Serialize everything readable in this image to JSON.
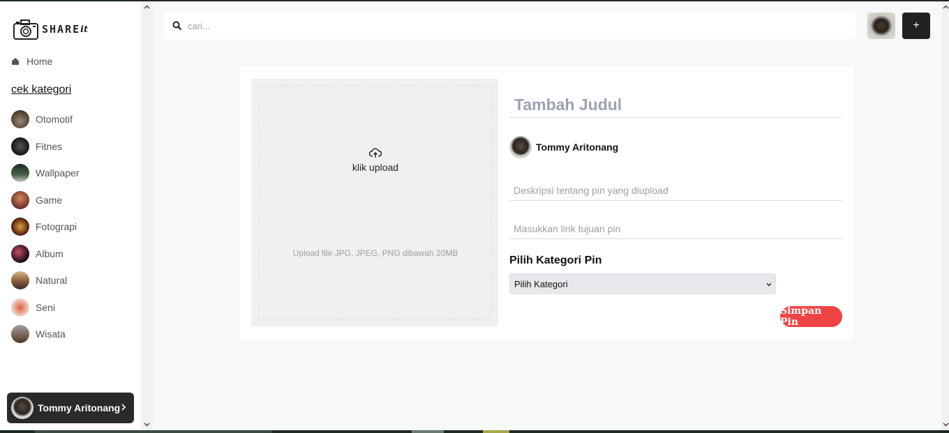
{
  "brand": {
    "name": "SHARE",
    "suffix": "it"
  },
  "sidebar": {
    "home_label": "Home",
    "category_heading": "cek kategori",
    "categories": [
      {
        "label": "Otomotif",
        "color": "#6b5a4a"
      },
      {
        "label": "Fitnes",
        "color": "#2d2d2d"
      },
      {
        "label": "Wallpaper",
        "color": "#3f4f3f"
      },
      {
        "label": "Game",
        "color": "#7a3a2a"
      },
      {
        "label": "Fotograpi",
        "color": "#5a2a1a"
      },
      {
        "label": "Album",
        "color": "#3a1a2a"
      },
      {
        "label": "Natural",
        "color": "#8a6a4a"
      },
      {
        "label": "Seni",
        "color": "#c04030"
      },
      {
        "label": "Wisata",
        "color": "#6a5a4a"
      }
    ],
    "user_name": "Tommy Aritonang"
  },
  "header": {
    "search_placeholder": "cari...",
    "add_label": "+"
  },
  "upload": {
    "label": "klik upload",
    "note": "Upload file JPG, JPEG, PNG dibawah 20MB"
  },
  "form": {
    "title_placeholder": "Tambah Judul",
    "author_name": "Tommy Aritonang",
    "description_placeholder": "Deskripsi tentang pin yang diupload",
    "link_placeholder": "Masukkan link tujuan pin",
    "category_title": "Pilih Kategori Pin",
    "category_selected": "Pilih Kategori",
    "save_label": "Simpan Pin"
  },
  "colors": {
    "accent": "#ef4444",
    "dark": "#222222"
  }
}
